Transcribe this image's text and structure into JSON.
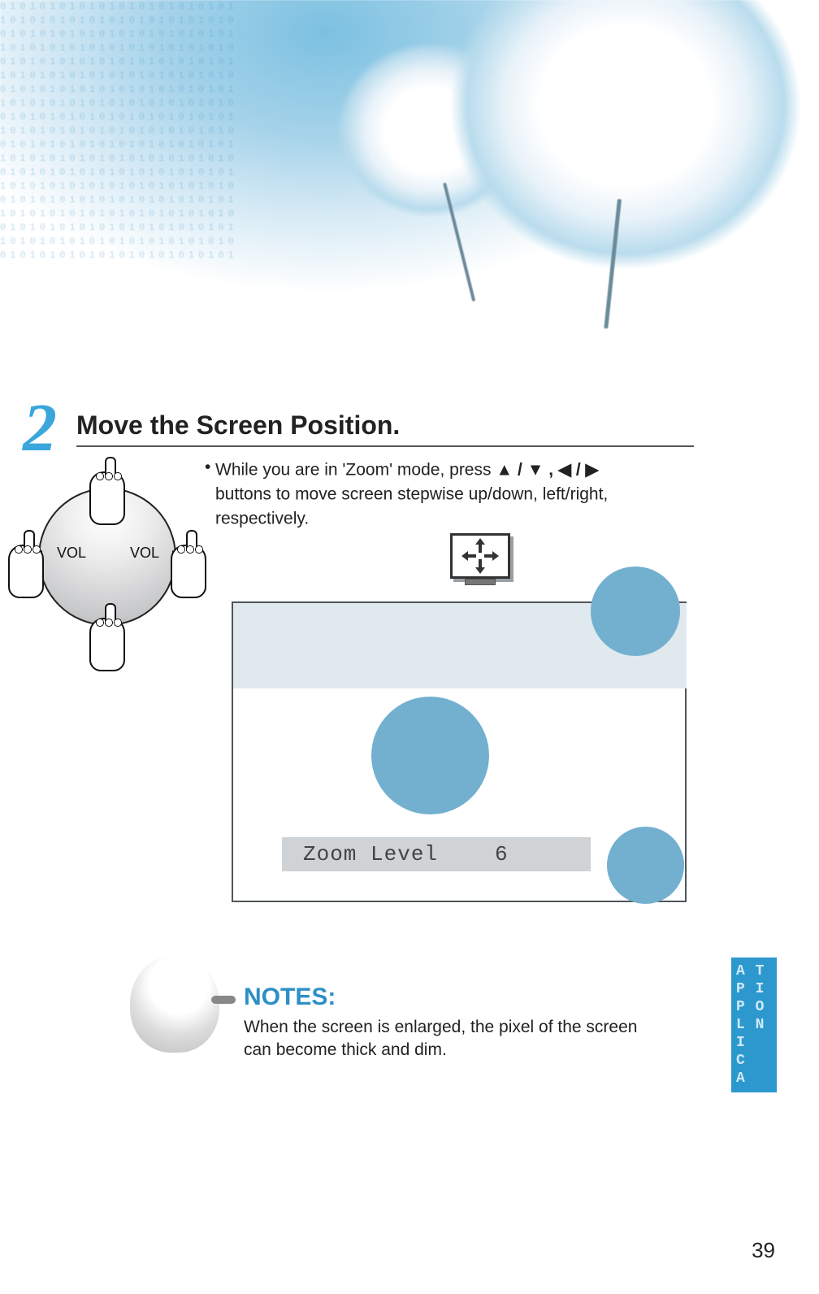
{
  "step": {
    "number": "2",
    "title": "Move the Screen Position.",
    "instruction_line1": "While you are in 'Zoom' mode, press ",
    "instruction_arrows1": "▲ / ▼ ,  ◀ / ▶",
    "instruction_line2": "buttons to move screen stepwise up/down, left/right,",
    "instruction_line3": "respectively."
  },
  "dpad": {
    "vol_left": "VOL",
    "vol_right": "VOL"
  },
  "zoom_display": {
    "label": "Zoom  Level",
    "value": "6"
  },
  "notes": {
    "heading": "NOTES:",
    "body": "When the screen is enlarged, the pixel of the screen can become thick and dim."
  },
  "side_tab": {
    "text": "A T\nP I\nP O\nL N\nI\nC\nA"
  },
  "page_number": "39"
}
